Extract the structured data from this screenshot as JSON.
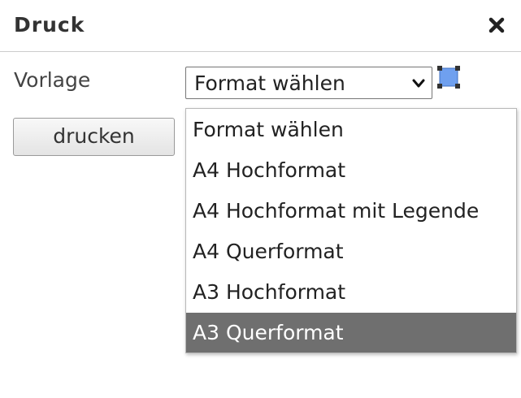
{
  "dialog": {
    "title": "Druck",
    "close_icon": "close-icon"
  },
  "form": {
    "template_label": "Vorlage",
    "template_select": {
      "current_value": "Format wählen",
      "arrow_icon": "chevron-down-icon",
      "extent_icon": "select-extent-icon",
      "extent_icon_color": "#3f80e0"
    },
    "print_button_label": "drucken"
  },
  "dropdown": {
    "options": [
      {
        "label": "Format wählen",
        "highlighted": false
      },
      {
        "label": "A4 Hochformat",
        "highlighted": false
      },
      {
        "label": "A4 Hochformat mit Legende",
        "highlighted": false
      },
      {
        "label": "A4 Querformat",
        "highlighted": false
      },
      {
        "label": "A3 Hochformat",
        "highlighted": false
      },
      {
        "label": "A3 Querformat",
        "highlighted": true
      }
    ],
    "highlight_color": "#6f6f6f"
  }
}
